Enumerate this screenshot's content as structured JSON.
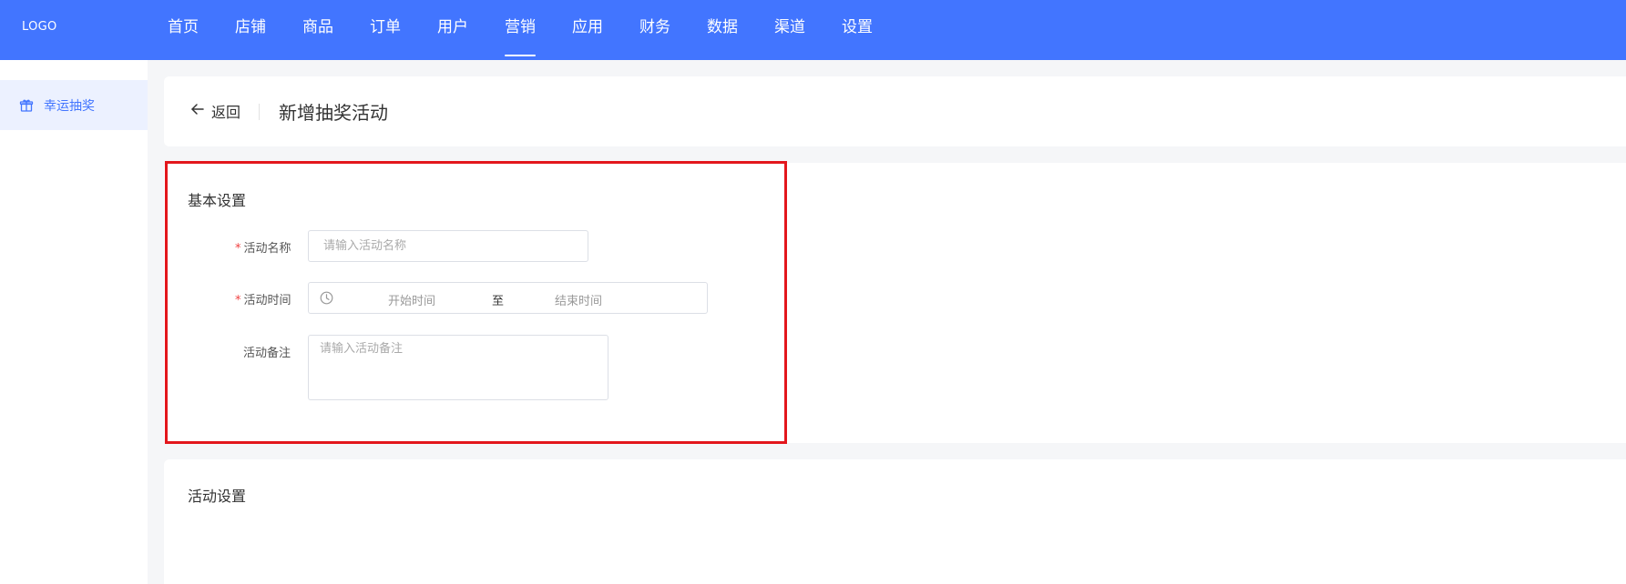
{
  "app": {
    "logo_text": "LOGO",
    "accent_color": "#4275ff",
    "highlight_color": "#e3161c"
  },
  "nav": {
    "items": [
      {
        "label": "首页"
      },
      {
        "label": "店铺"
      },
      {
        "label": "商品"
      },
      {
        "label": "订单"
      },
      {
        "label": "用户"
      },
      {
        "label": "营销",
        "active": true
      },
      {
        "label": "应用"
      },
      {
        "label": "财务"
      },
      {
        "label": "数据"
      },
      {
        "label": "渠道"
      },
      {
        "label": "设置"
      }
    ]
  },
  "sidebar": {
    "items": [
      {
        "label": "幸运抽奖",
        "icon": "gift-icon",
        "active": true
      }
    ]
  },
  "header": {
    "back_label": "返回",
    "back_icon": "arrow-left-icon",
    "title": "新增抽奖活动"
  },
  "basic_settings": {
    "title": "基本设置",
    "required_mark": "*",
    "name_field": {
      "label": "活动名称",
      "placeholder": "请输入活动名称",
      "required": true
    },
    "time_field": {
      "label": "活动时间",
      "start_placeholder": "开始时间",
      "separator": "至",
      "end_placeholder": "结束时间",
      "icon": "clock-icon",
      "required": true
    },
    "remark_field": {
      "label": "活动备注",
      "placeholder": "请输入活动备注",
      "required": false
    }
  },
  "activity_settings": {
    "title": "活动设置"
  }
}
